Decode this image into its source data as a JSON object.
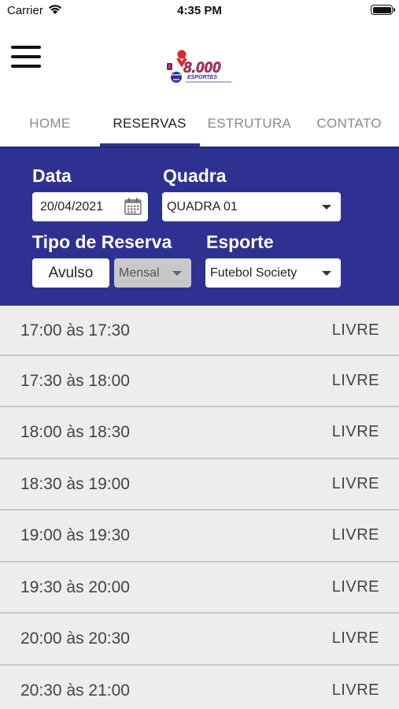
{
  "status_bar": {
    "carrier": "Carrier",
    "time": "4:35 PM"
  },
  "header": {
    "logo_number": "8.000",
    "logo_word": "ESPORTES"
  },
  "tabs": [
    {
      "label": "HOME",
      "active": false
    },
    {
      "label": "RESERVAS",
      "active": true
    },
    {
      "label": "ESTRUTURA",
      "active": false
    },
    {
      "label": "CONTATO",
      "active": false
    }
  ],
  "form": {
    "date_label": "Data",
    "date_value": "20/04/2021",
    "quadra_label": "Quadra",
    "quadra_value": "QUADRA 01",
    "tipo_label": "Tipo de Reserva",
    "tipo_options": [
      "Avulso",
      "Mensal"
    ],
    "esporte_label": "Esporte",
    "esporte_value": "Futebol Society"
  },
  "slots": [
    {
      "time": "17:00 às 17:30",
      "status": "LIVRE"
    },
    {
      "time": "17:30 às 18:00",
      "status": "LIVRE"
    },
    {
      "time": "18:00 às 18:30",
      "status": "LIVRE"
    },
    {
      "time": "18:30 às 19:00",
      "status": "LIVRE"
    },
    {
      "time": "19:00 às 19:30",
      "status": "LIVRE"
    },
    {
      "time": "19:30 às 20:00",
      "status": "LIVRE"
    },
    {
      "time": "20:00 às 20:30",
      "status": "LIVRE"
    },
    {
      "time": "20:30 às 21:00",
      "status": "LIVRE"
    }
  ],
  "colors": {
    "primary": "#2e3192",
    "list_bg": "#ededed",
    "logo_red": "#e3262e"
  }
}
